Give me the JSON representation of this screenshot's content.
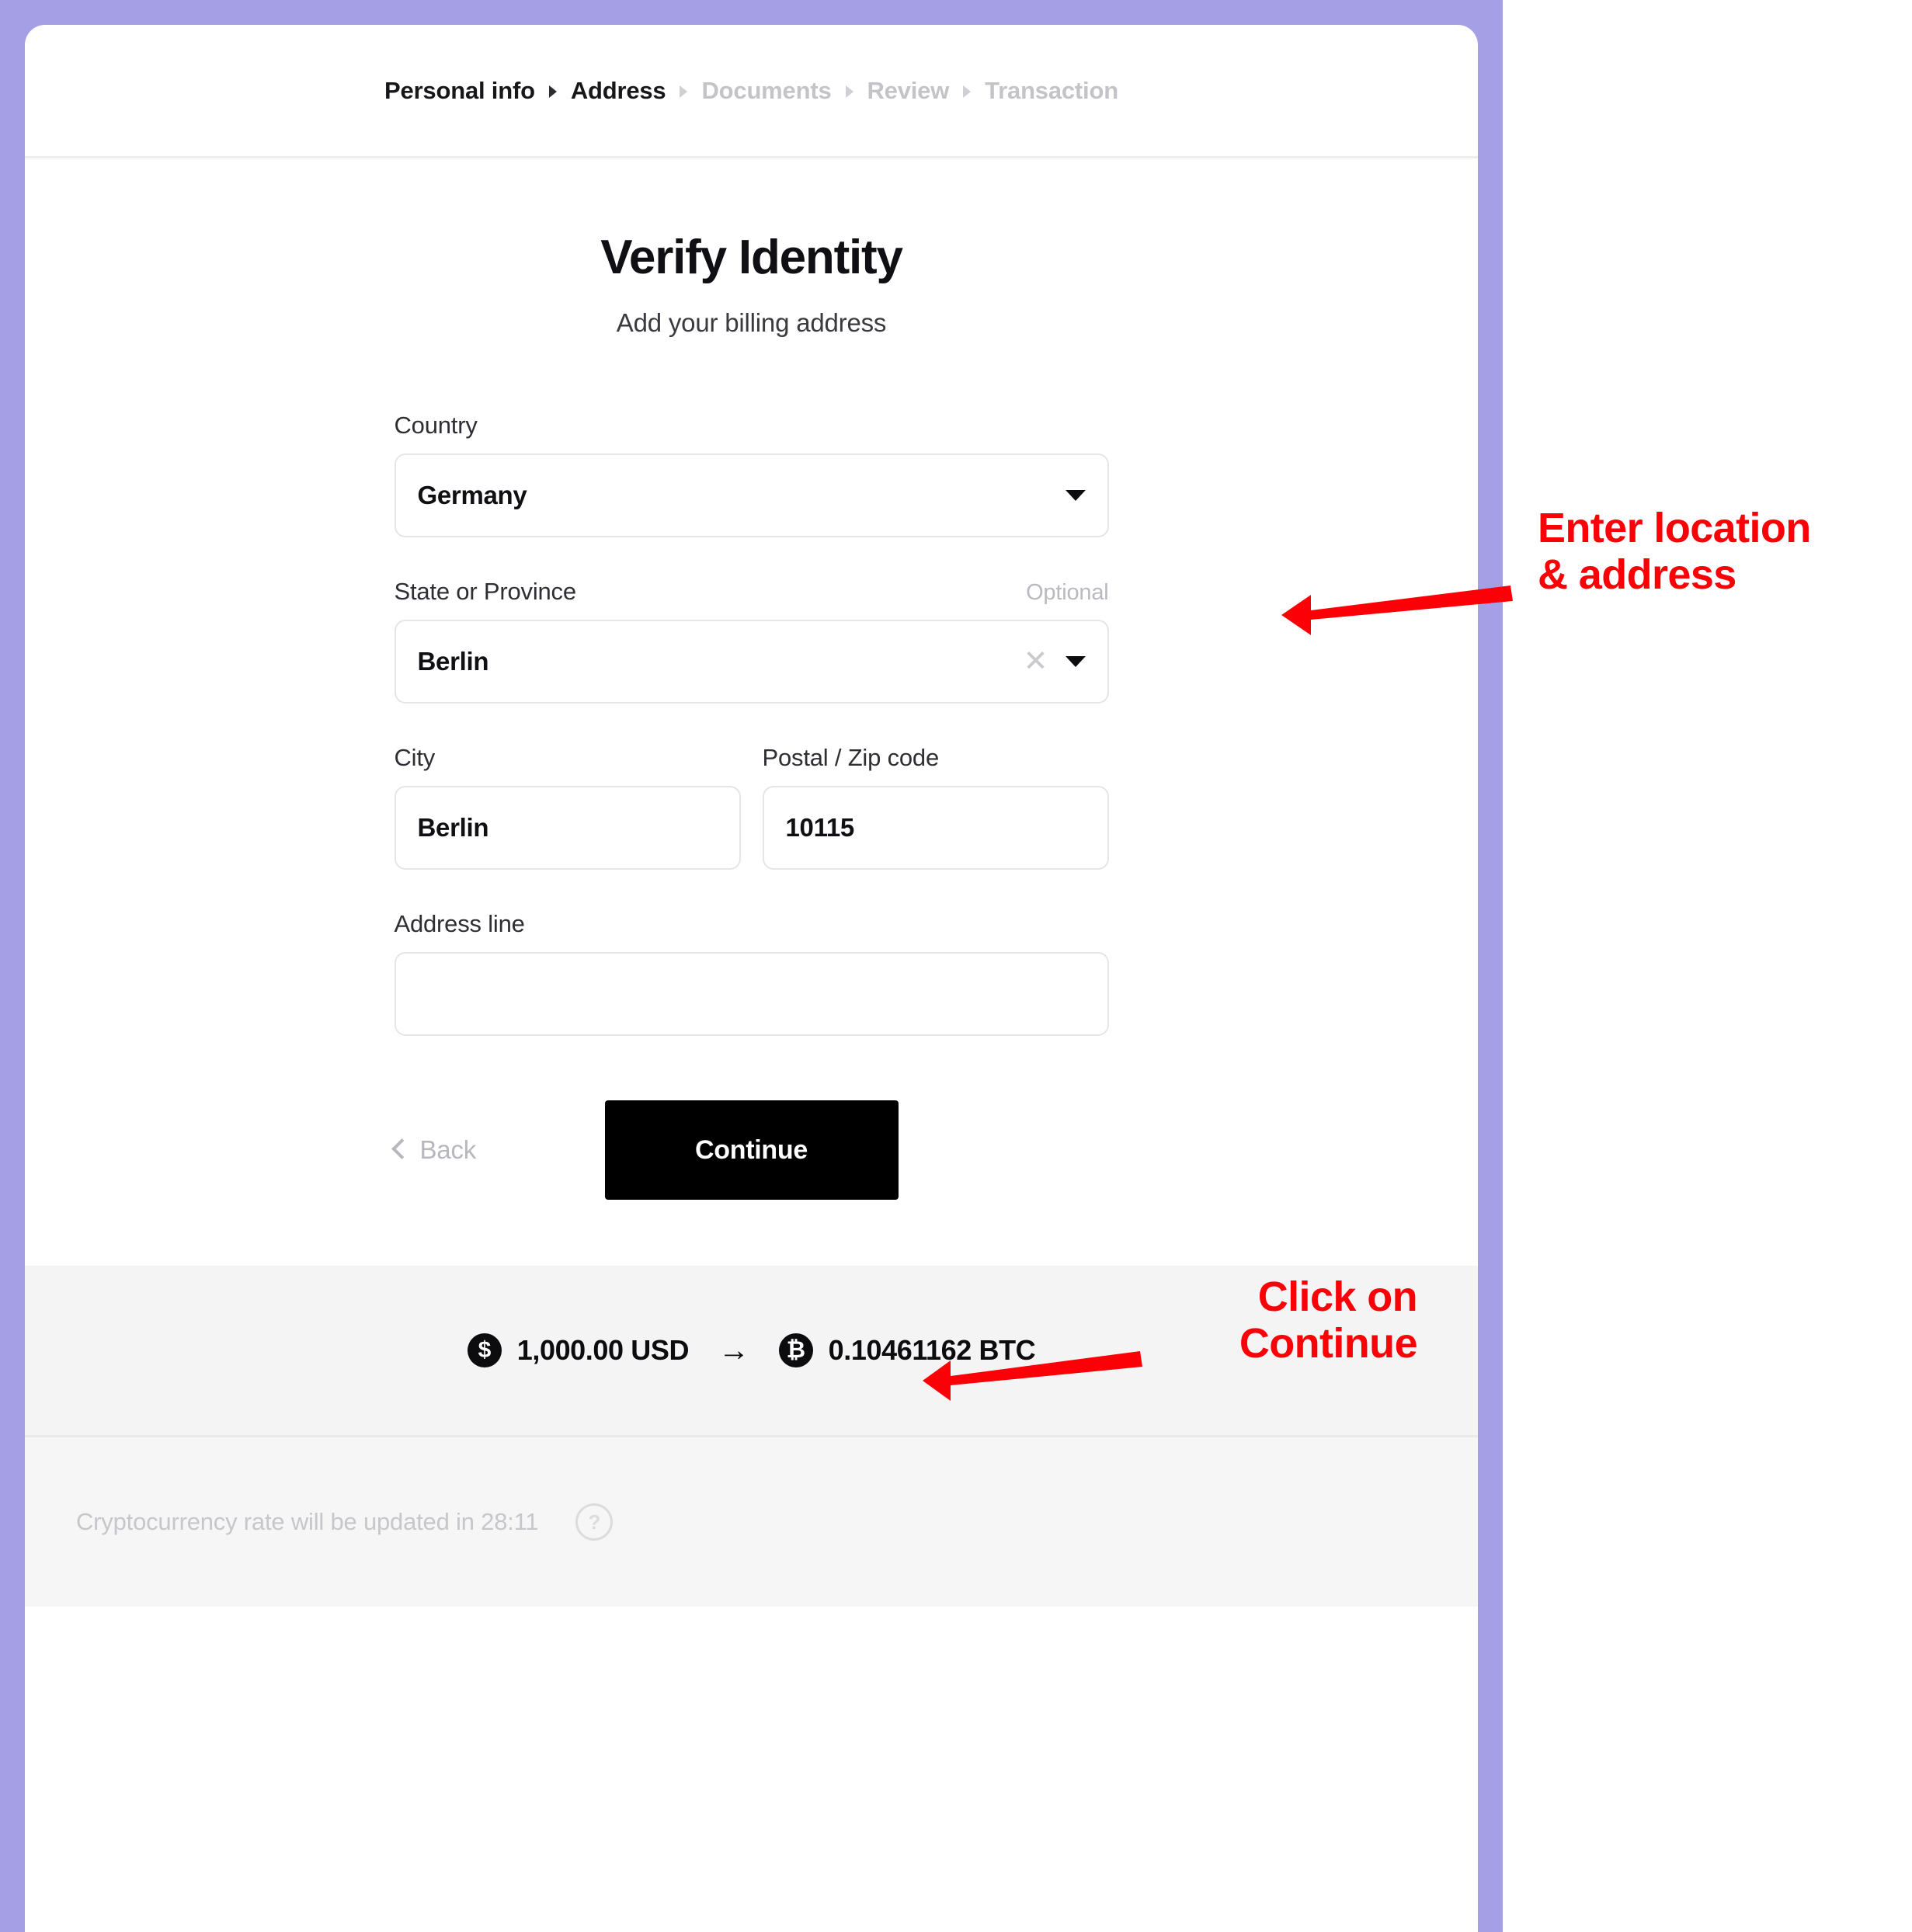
{
  "frame": {
    "border_color": "#a5a0e6"
  },
  "breadcrumb": {
    "steps": [
      {
        "label": "Personal info",
        "state": "done"
      },
      {
        "label": "Address",
        "state": "current"
      },
      {
        "label": "Documents",
        "state": "upcoming"
      },
      {
        "label": "Review",
        "state": "upcoming"
      },
      {
        "label": "Transaction",
        "state": "upcoming"
      }
    ]
  },
  "page": {
    "title": "Verify Identity",
    "subtitle": "Add your billing address"
  },
  "form": {
    "country": {
      "label": "Country",
      "value": "Germany",
      "dropdown_icon": "caret-down-icon"
    },
    "state": {
      "label": "State or Province",
      "optional_label": "Optional",
      "value": "Berlin",
      "clear_icon": "close-x-icon",
      "dropdown_icon": "caret-down-icon"
    },
    "city": {
      "label": "City",
      "value": "Berlin"
    },
    "postal": {
      "label": "Postal / Zip code",
      "value": "10115"
    },
    "address_line": {
      "label": "Address line",
      "value": "",
      "placeholder": ""
    }
  },
  "actions": {
    "back_label": "Back",
    "back_icon": "chevron-left-icon",
    "continue_label": "Continue"
  },
  "exchange": {
    "from_icon": "usd-coin-icon",
    "from_symbol": "$",
    "from_amount": "1,000.00 USD",
    "arrow": "→",
    "to_icon": "btc-coin-icon",
    "to_symbol": "₿",
    "to_amount": "0.10461162 BTC"
  },
  "rate_status": {
    "text": "Cryptocurrency rate will be updated in 28:11",
    "help_icon": "help-circle-icon",
    "help_glyph": "?"
  },
  "annotations": {
    "color": "#fb0007",
    "location": {
      "line1": "Enter location",
      "line2": "& address"
    },
    "continue": {
      "line1": "Click on",
      "line2": "Continue"
    }
  }
}
